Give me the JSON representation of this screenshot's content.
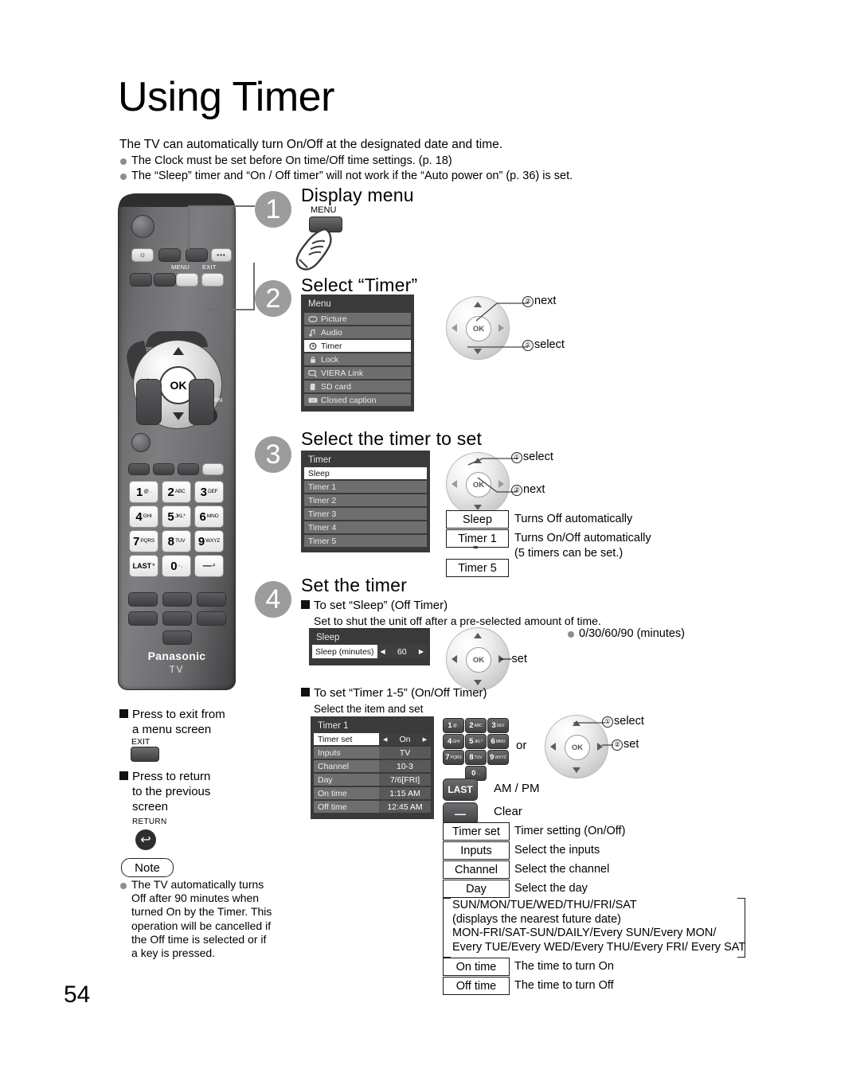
{
  "page": {
    "title": "Using Timer",
    "number": "54"
  },
  "intro": {
    "lead": "The TV can automatically turn On/Off at the designated date and time.",
    "bullets": [
      "The Clock must be set before On time/Off time settings. (p. 18)",
      "The “Sleep” timer and “On / Off timer” will not work if the “Auto power on” (p. 36) is set."
    ]
  },
  "remote": {
    "menu_label": "MENU",
    "exit_label": "EXIT",
    "return_label": "RETURN",
    "ok_label": "OK",
    "brand": "Panasonic",
    "brand_sub": "TV",
    "keys": [
      {
        "num": "1",
        "sub": "@ ."
      },
      {
        "num": "2",
        "sub": "ABC"
      },
      {
        "num": "3",
        "sub": "DEF"
      },
      {
        "num": "4",
        "sub": "GHI"
      },
      {
        "num": "5",
        "sub": "JKL*"
      },
      {
        "num": "6",
        "sub": "MNO"
      },
      {
        "num": "7",
        "sub": "PQRS"
      },
      {
        "num": "8",
        "sub": "TUV"
      },
      {
        "num": "9",
        "sub": "WXYZ"
      },
      {
        "num": "LAST",
        "sub": "*"
      },
      {
        "num": "0",
        "sub": "- ,"
      },
      {
        "num": "—",
        "sub": "#"
      }
    ]
  },
  "steps": [
    {
      "no": "1",
      "heading": "Display menu"
    },
    {
      "no": "2",
      "heading": "Select “Timer”"
    },
    {
      "no": "3",
      "heading": "Select the timer to set"
    },
    {
      "no": "4",
      "heading": "Set the timer"
    }
  ],
  "step1": {
    "button_label": "MENU"
  },
  "step2": {
    "menu_title": "Menu",
    "items": [
      {
        "label": "Picture",
        "icon": "picture-icon",
        "selected": false
      },
      {
        "label": "Audio",
        "icon": "audio-note-icon",
        "selected": false
      },
      {
        "label": "Timer",
        "icon": "clock-icon",
        "selected": true
      },
      {
        "label": "Lock",
        "icon": "lock-icon",
        "selected": false
      },
      {
        "label": "VIERA Link",
        "icon": "viera-link-icon",
        "selected": false
      },
      {
        "label": "SD card",
        "icon": "sd-card-icon",
        "selected": false
      },
      {
        "label": "Closed caption",
        "icon": "closed-caption-icon",
        "selected": false
      }
    ],
    "annot_next": "next",
    "annot_next_no": "②",
    "annot_select": "select",
    "annot_select_no": "①"
  },
  "step3": {
    "panel_title": "Timer",
    "items": [
      {
        "label": "Sleep",
        "selected": true
      },
      {
        "label": "Timer 1",
        "selected": false
      },
      {
        "label": "Timer 2",
        "selected": false
      },
      {
        "label": "Timer 3",
        "selected": false
      },
      {
        "label": "Timer 4",
        "selected": false
      },
      {
        "label": "Timer 5",
        "selected": false
      }
    ],
    "annot_select_no": "①",
    "annot_select": "select",
    "annot_next_no": "②",
    "annot_next": "next",
    "legend": [
      {
        "key": "Sleep",
        "desc": "Turns Off automatically"
      },
      {
        "key": "Timer 1",
        "desc": "Turns On/Off automatically"
      },
      {
        "key": "Timer 5",
        "desc": "(5 timers can be set.)"
      }
    ],
    "tilde": "≈"
  },
  "step4": {
    "sleep_section": {
      "heading": "To set “Sleep” (Off Timer)",
      "sub": "Set to shut the unit off after a pre-selected amount of time.",
      "panel_title": "Sleep",
      "row_label": "Sleep (minutes)",
      "row_value": "60",
      "set_label": "set",
      "options_note": "0/30/60/90 (minutes)"
    },
    "timer_section": {
      "heading": "To set “Timer 1-5” (On/Off Timer)",
      "sub": "Select the item and set",
      "panel_title": "Timer 1",
      "rows": [
        {
          "key": "Timer set",
          "value": "On",
          "selected": true
        },
        {
          "key": "Inputs",
          "value": "TV",
          "selected": false
        },
        {
          "key": "Channel",
          "value": "10-3",
          "selected": false
        },
        {
          "key": "Day",
          "value": "7/6[FRI]",
          "selected": false
        },
        {
          "key": "On time",
          "value": "1:15 AM",
          "selected": false
        },
        {
          "key": "Off time",
          "value": "12:45 AM",
          "selected": false
        }
      ],
      "or_label": "or",
      "annot_select_no": "①",
      "annot_select": "select",
      "annot_set_no": "②",
      "annot_set": "set",
      "last_key": "LAST",
      "last_desc": "AM / PM",
      "minus_key": "—",
      "minus_desc": "Clear",
      "legend": [
        {
          "key": "Timer set",
          "desc": "Timer setting (On/Off)"
        },
        {
          "key": "Inputs",
          "desc": "Select the inputs"
        },
        {
          "key": "Channel",
          "desc": "Select the channel"
        },
        {
          "key": "Day",
          "desc": "Select the day"
        }
      ],
      "day_options": [
        "SUN/MON/TUE/WED/THU/FRI/SAT",
        "(displays the nearest future date)",
        "MON-FRI/SAT-SUN/DAILY/Every SUN/Every MON/",
        "Every TUE/Every WED/Every THU/Every FRI/ Every SAT"
      ],
      "legend2": [
        {
          "key": "On time",
          "desc": "The time to turn On"
        },
        {
          "key": "Off time",
          "desc": "The time to turn Off"
        }
      ]
    }
  },
  "sidebar": {
    "exit_note": {
      "line1": "Press to exit from",
      "line2": "a menu screen",
      "key": "EXIT"
    },
    "return_note": {
      "line1": "Press to return",
      "line2": "to the previous",
      "line3": "screen",
      "key": "RETURN"
    },
    "note_label": "Note",
    "note_lines": [
      "The TV automatically",
      "turns Off after 90",
      "minutes when turned",
      "On by the Timer.",
      "This operation will be",
      "cancelled if the Off",
      "time is selected or if a",
      "key is pressed."
    ]
  }
}
